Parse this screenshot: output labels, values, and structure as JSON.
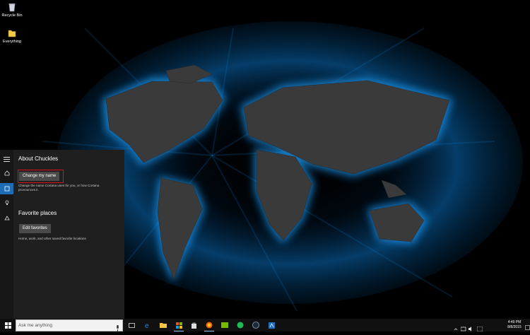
{
  "desktop": {
    "icons": [
      {
        "label": "Recycle Bin",
        "icon": "recycle-bin-icon"
      },
      {
        "label": "Everything",
        "icon": "folder-icon"
      }
    ]
  },
  "cortana": {
    "title": "About Chuckles",
    "change_name_button": "Change my name",
    "change_name_desc_line1": "Change the name Cortana uses for you, or how Cortana",
    "change_name_desc_line2": "pronounces it.",
    "favorites_heading": "Favorite places",
    "edit_favorites_button": "Edit favorites",
    "favorites_desc": "Home, work, and other saved favorite locations",
    "rail": [
      "menu-icon",
      "home-icon",
      "notebook-icon",
      "lightbulb-icon",
      "feedback-icon"
    ]
  },
  "taskbar": {
    "search_placeholder": "Ask me anything",
    "apps": [
      "task-view-icon",
      "edge-icon",
      "file-explorer-icon",
      "store-icon",
      "app-icon",
      "firefox-icon",
      "nvidia-icon",
      "spotify-icon",
      "steam-icon",
      "app2-icon"
    ],
    "time": "4:49 PM",
    "date": "8/8/2015"
  },
  "colors": {
    "accent": "#1e6bb8",
    "highlight": "#e0101a",
    "panel_bg": "#1f1f1f"
  }
}
